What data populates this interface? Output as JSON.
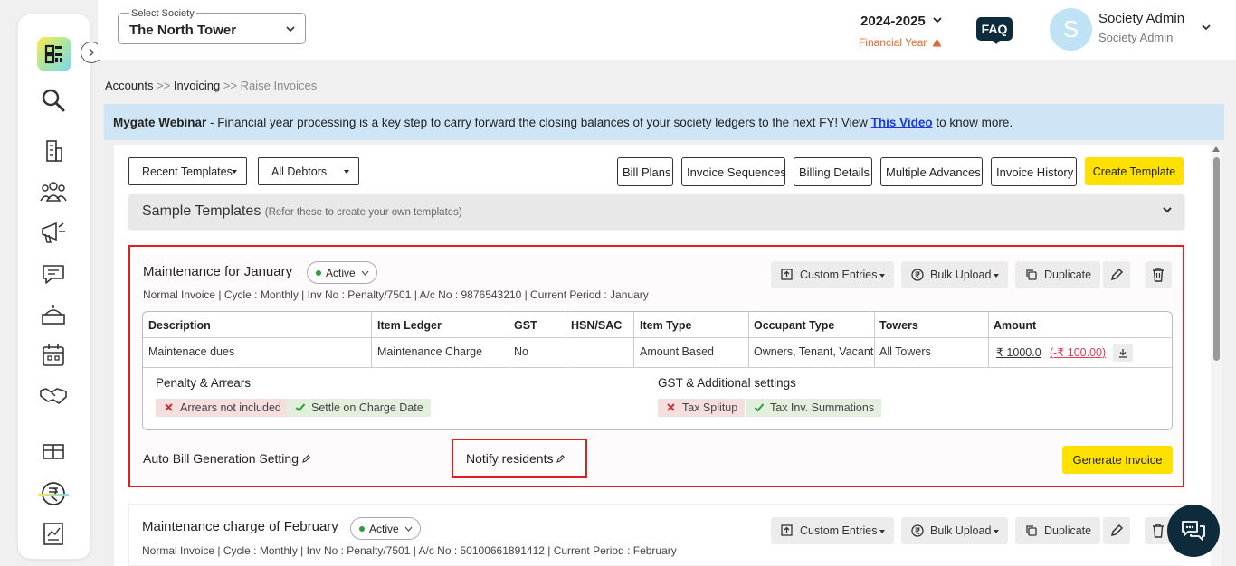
{
  "header": {
    "society_label": "Select Society",
    "society_value": "The North Tower",
    "financial_year": "2024-2025",
    "financial_year_label": "Financial Year",
    "faq": "FAQ",
    "avatar_initial": "S",
    "user_name": "Society Admin",
    "user_role": "Society Admin"
  },
  "sidebar": {
    "items": [
      "search-icon",
      "building-icon",
      "people-icon",
      "megaphone-icon",
      "chat-icon",
      "service-icon",
      "calendar-icon",
      "handshake-icon",
      "gift-icon",
      "rupee-icon",
      "report-icon"
    ],
    "active": "rupee-icon"
  },
  "breadcrumb": {
    "items": [
      "Accounts",
      "Invoicing",
      "Raise Invoices"
    ],
    "separator": ">>"
  },
  "banner": {
    "brand": "Mygate Webinar",
    "text": " - Financial year processing is a key step to carry forward the closing balances of your society ledgers to the next FY! View ",
    "link": "This Video",
    "suffix": " to know more."
  },
  "toolbar": {
    "recent_templates": "Recent Templates",
    "all_debtors": "All Debtors",
    "bill_plans": "Bill Plans",
    "invoice_sequences": "Invoice Sequences",
    "billing_details": "Billing Details",
    "multiple_advances": "Multiple Advances",
    "invoice_history": "Invoice History",
    "create_template": "Create Template"
  },
  "sample_templates": {
    "title": "Sample Templates",
    "subtitle": "(Refer these to create your own templates)"
  },
  "actions": {
    "custom_entries": "Custom Entries",
    "bulk_upload": "Bulk Upload",
    "duplicate": "Duplicate"
  },
  "table_headers": [
    "Description",
    "Item Ledger",
    "GST",
    "HSN/SAC",
    "Item Type",
    "Occupant Type",
    "Towers",
    "Amount"
  ],
  "templates": [
    {
      "title": "Maintenance for January",
      "status": "Active",
      "meta": "Normal Invoice | Cycle : Monthly | Inv No : Penalty/7501 | A/c No : 9876543210 | Current Period : January",
      "row": {
        "description": "Maintenace dues",
        "item_ledger": "Maintenance Charge",
        "gst": "No",
        "hsn_sac": "",
        "item_type": "Amount Based",
        "occupant_type": "Owners, Tenant, Vacant",
        "towers": "All Towers",
        "amount": "₹ 1000.0",
        "amount_discount": "(-₹ 100.00)"
      },
      "penalty_title": "Penalty & Arrears",
      "penalty_tags": [
        "Arrears not included",
        "Settle on Charge Date"
      ],
      "gst_title": "GST & Additional settings",
      "gst_tags": [
        "Tax Splitup",
        "Tax Inv. Summations"
      ],
      "auto_bill": "Auto Bill Generation Setting",
      "notify": "Notify residents",
      "generate": "Generate Invoice"
    },
    {
      "title": "Maintenance charge of February",
      "status": "Active",
      "meta": "Normal Invoice | Cycle : Monthly | Inv No : Penalty/7501 | A/c No : 50100661891412 | Current Period : February"
    }
  ]
}
